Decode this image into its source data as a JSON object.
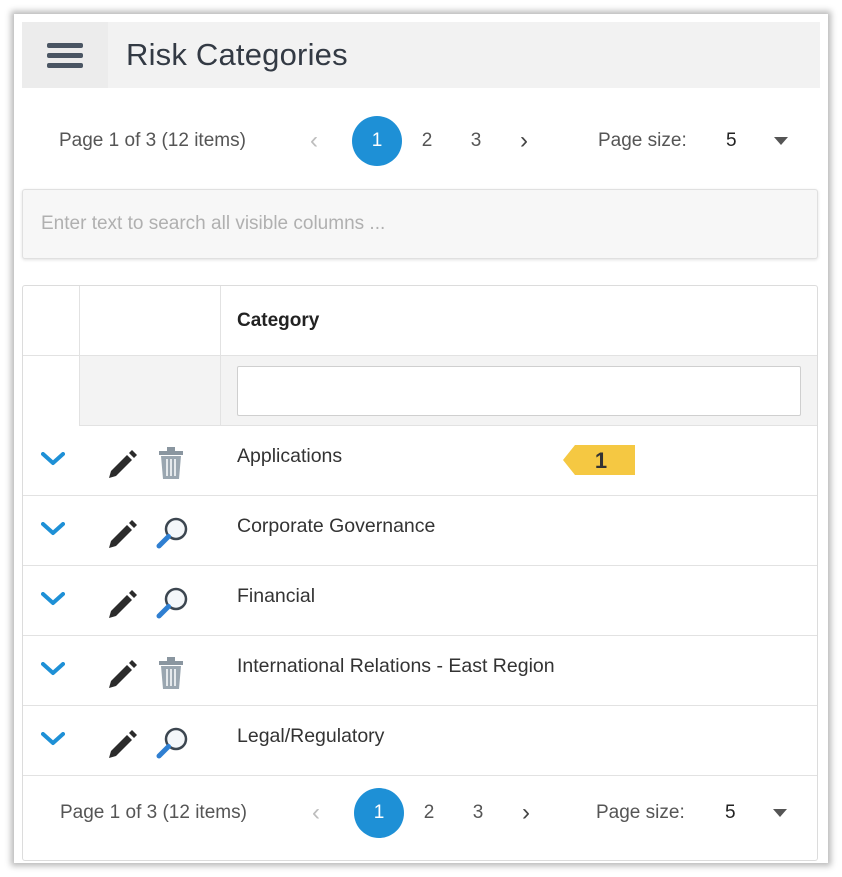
{
  "header": {
    "title": "Risk Categories"
  },
  "pager": {
    "summary": "Page 1 of 3 (12 items)",
    "pages": [
      "1",
      "2",
      "3"
    ],
    "active_page": "1",
    "page_size_label": "Page size:",
    "page_size_value": "5"
  },
  "search": {
    "placeholder": "Enter text to search all visible columns ..."
  },
  "grid": {
    "column_header": "Category",
    "rows": [
      {
        "category": "Applications",
        "icon2": "trash-icon"
      },
      {
        "category": "Corporate Governance",
        "icon2": "magnifier-icon"
      },
      {
        "category": "Financial",
        "icon2": "magnifier-icon"
      },
      {
        "category": "International Relations - East Region",
        "icon2": "trash-icon"
      },
      {
        "category": "Legal/Regulatory",
        "icon2": "magnifier-icon"
      }
    ]
  },
  "callout": {
    "label": "1",
    "color": "#f5c842"
  },
  "colors": {
    "accent": "#1e90d6",
    "header_bg": "#f2f2f2"
  }
}
